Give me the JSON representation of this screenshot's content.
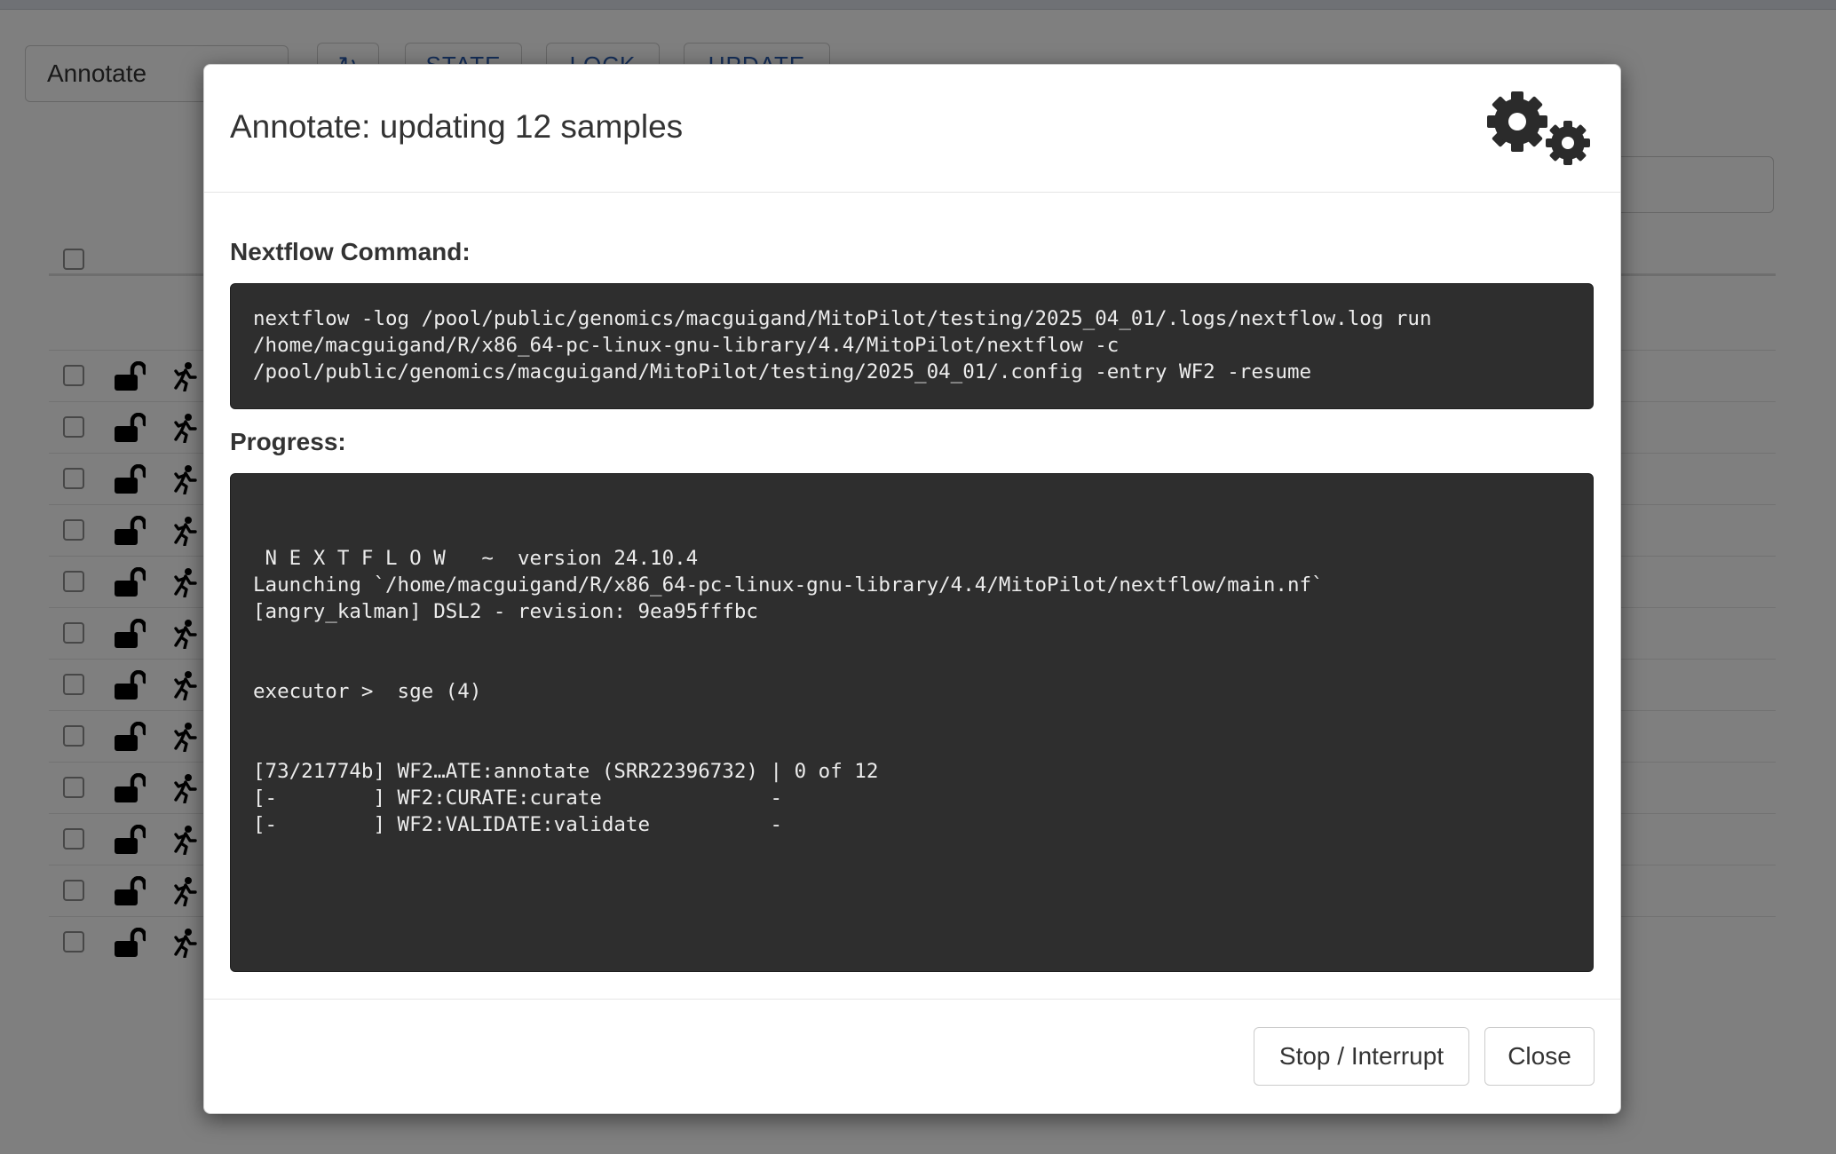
{
  "toolbar": {
    "mode_select_value": "Annotate",
    "state_button": "STATE",
    "lock_button": "LOCK",
    "update_button": "UPDATE"
  },
  "sample_rows": 12,
  "modal": {
    "title": "Annotate: updating 12 samples",
    "icon": "gears-icon",
    "command_label": "Nextflow Command:",
    "command_lines": [
      "nextflow -log /pool/public/genomics/macguigand/MitoPilot/testing/2025_04_01/.logs/nextflow.log run",
      "/home/macguigand/R/x86_64-pc-linux-gnu-library/4.4/MitoPilot/nextflow -c",
      "/pool/public/genomics/macguigand/MitoPilot/testing/2025_04_01/.config -entry WF2 -resume"
    ],
    "progress_label": "Progress:",
    "progress_lines": [
      " N E X T F L O W   ~  version 24.10.4",
      "Launching `/home/macguigand/R/x86_64-pc-linux-gnu-library/4.4/MitoPilot/nextflow/main.nf`",
      "[angry_kalman] DSL2 - revision: 9ea95fffbc",
      "",
      "",
      "executor >  sge (4)",
      "",
      "",
      "[73/21774b] WF2…ATE:annotate (SRR22396732) | 0 of 12",
      "[-        ] WF2:CURATE:curate              -",
      "[-        ] WF2:VALIDATE:validate          -"
    ],
    "stop_button": "Stop / Interrupt",
    "close_button": "Close"
  },
  "colors": {
    "console_bg": "#2e2e2e",
    "console_text": "#ececec",
    "overlay": "rgba(0,0,0,0.5)",
    "link_blue": "#2a5db0"
  }
}
